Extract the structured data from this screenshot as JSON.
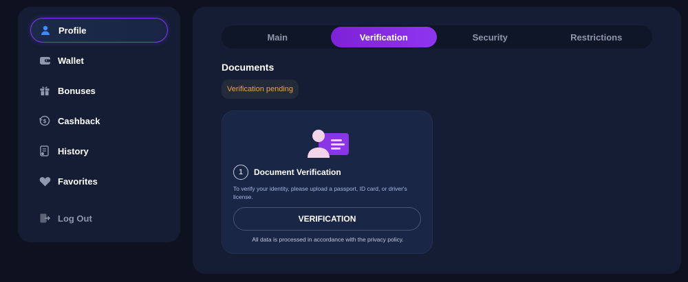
{
  "sidebar": {
    "items": [
      {
        "label": "Profile",
        "icon": "user-icon",
        "active": true
      },
      {
        "label": "Wallet",
        "icon": "wallet-icon"
      },
      {
        "label": "Bonuses",
        "icon": "gift-icon"
      },
      {
        "label": "Cashback",
        "icon": "cashback-icon"
      },
      {
        "label": "History",
        "icon": "history-icon"
      },
      {
        "label": "Favorites",
        "icon": "heart-icon"
      }
    ],
    "logout_label": "Log Out"
  },
  "tabs": [
    {
      "label": "Main"
    },
    {
      "label": "Verification",
      "active": true
    },
    {
      "label": "Security"
    },
    {
      "label": "Restrictions"
    }
  ],
  "documents": {
    "title": "Documents",
    "status": "Verification pending",
    "status_color": "#f2a33a",
    "card": {
      "step_number": "1",
      "step_title": "Document Verification",
      "description": "To verify your identity, please upload a passport, ID card, or driver's license.",
      "button_label": "VERIFICATION",
      "privacy_note": "All data is processed in accordance with the privacy policy."
    }
  },
  "colors": {
    "accent": "#8a2be2",
    "panel": "#141d33",
    "background": "#0d1120"
  }
}
